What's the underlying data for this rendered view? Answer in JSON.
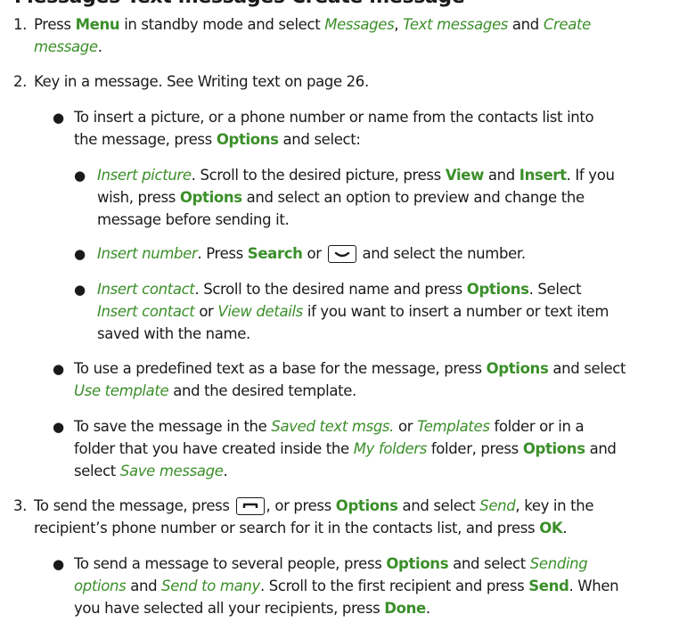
{
  "heading_fragment": "Messages  Text messages  Create message",
  "step1": {
    "num": "1.",
    "a": "Press ",
    "menu": "Menu",
    "b": " in standby mode and select ",
    "messages": "Messages",
    "comma": ",",
    "text_messages": "Text messages",
    "and": " and ",
    "create1": "Create",
    "create2": "message",
    "end": "."
  },
  "step2": {
    "num": "2.",
    "text": "Key in a message. See Writing text on page 26.",
    "b1": {
      "l1": "To insert a picture, or a phone number or name from the contacts list into",
      "l2a": "the message, press ",
      "options": "Options",
      "l2b": " and select:"
    },
    "insert_picture": {
      "name": "Insert picture",
      "a": ". Scroll to the desired picture, press ",
      "view": "View",
      "and": " and ",
      "insert": "Insert",
      "b": ". If you",
      "l2a": "wish, press ",
      "options": "Options",
      "l2b": " and select an option to preview and change the",
      "l3": "message before sending it."
    },
    "insert_number": {
      "name": "Insert number",
      "a": ". Press ",
      "search": "Search",
      "or": " or ",
      "key_icon": "scroll-down-key-icon",
      "b": " and select the number."
    },
    "insert_contact": {
      "name": "Insert contact",
      "a": ". Scroll to the desired name and press ",
      "options": "Options",
      "b": ". Select",
      "opt1": "Insert contact",
      "or": " or ",
      "opt2": "View details",
      "c": " if you want to insert a number or text item",
      "l3": "saved with the name."
    },
    "b2": {
      "a": "To use a predefined text as a base for the message, press ",
      "options": "Options",
      "b": " and select",
      "template": "Use template",
      "c": " and the desired template."
    },
    "b3": {
      "a": "To save the message in the ",
      "saved": "Saved text msgs.",
      "or": " or ",
      "templates": "Templates",
      "b": " folder or in a",
      "l2a": "folder that you have created inside the ",
      "myfolders": "My folders",
      "l2b": " folder, press ",
      "options": "Options",
      "l2c": " and",
      "l3a": "select ",
      "save": "Save message",
      "l3b": "."
    }
  },
  "step3": {
    "num": "3.",
    "a": "To send the message, press ",
    "key_icon": "call-key-icon",
    "b": ", or press ",
    "options": "Options",
    "c": " and select ",
    "send": "Send",
    "d": ", key in the",
    "l2a": "recipient’s phone number or search for it in the contacts list, and press ",
    "ok": "OK",
    "l2b": ".",
    "b1": {
      "a": "To send a message to several people, press ",
      "options": "Options",
      "b": " and select ",
      "sending": "Sending",
      "l2a": "options",
      "and": " and ",
      "many": "Send to many",
      "l2b": ". Scroll to the first recipient and press ",
      "send": "Send",
      "l2c": ". When",
      "l3a": "you have selected all your recipients, press ",
      "done": "Done",
      "l3b": "."
    }
  },
  "colors": {
    "accent_green": "#3b8f2a",
    "text": "#1a1a1a"
  }
}
